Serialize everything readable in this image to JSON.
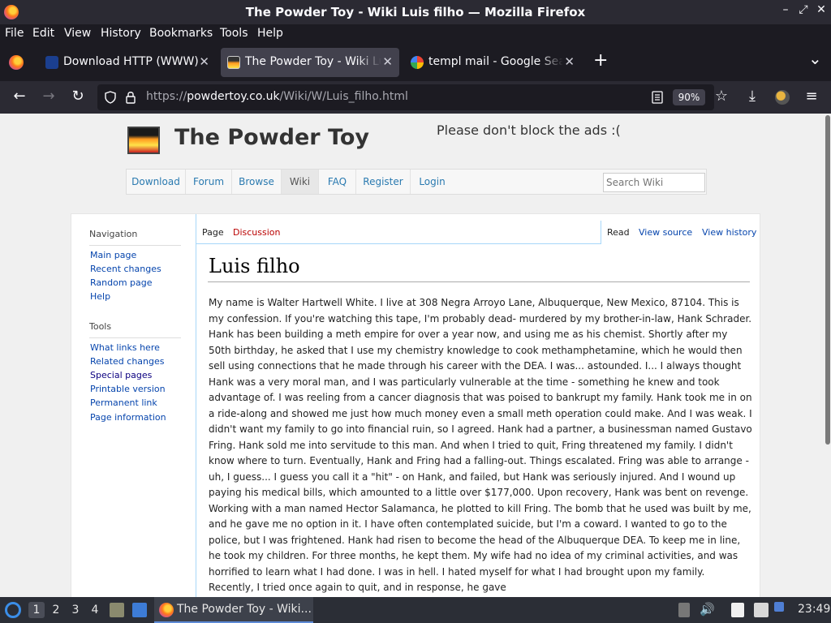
{
  "window": {
    "title": "The Powder Toy - Wiki Luis filho — Mozilla Firefox",
    "minimize": "–",
    "maximize": "⤢",
    "close": "✕"
  },
  "menu": [
    "File",
    "Edit",
    "View",
    "History",
    "Bookmarks",
    "Tools",
    "Help"
  ],
  "tabs": [
    {
      "label": "Download HTTP (WWW)",
      "active": false
    },
    {
      "label": "The Powder Toy - Wiki Lui",
      "active": true
    },
    {
      "label": "templ mail - Google Sear",
      "active": false
    }
  ],
  "tab_close": "✕",
  "new_tab": "+",
  "list_all_tabs": "⌄",
  "navbar": {
    "back": "←",
    "forward": "→",
    "reload": "↻",
    "url_prefix": "https://",
    "url_host": "powdertoy.co.uk",
    "url_path": "/Wiki/W/Luis_filho.html",
    "zoom": "90%",
    "bookmark_star": "☆",
    "downloads": "⤓",
    "menu": "≡"
  },
  "site": {
    "title": "The Powder Toy",
    "ads_message": "Please don't block the ads :(",
    "nav": [
      "Download",
      "Forum",
      "Browse",
      "Wiki",
      "FAQ",
      "Register",
      "Login"
    ],
    "search_placeholder": "Search Wiki"
  },
  "sidebar": {
    "navigation_heading": "Navigation",
    "navigation": [
      "Main page",
      "Recent changes",
      "Random page",
      "Help"
    ],
    "tools_heading": "Tools",
    "tools": [
      "What links here",
      "Related changes",
      "Special pages",
      "Printable version",
      "Permanent link",
      "Page information"
    ]
  },
  "content_tabs": {
    "page": "Page",
    "discussion": "Discussion",
    "read": "Read",
    "view_source": "View source",
    "view_history": "View history"
  },
  "article": {
    "title": "Luis filho",
    "body": "My name is Walter Hartwell White. I live at 308 Negra Arroyo Lane, Albuquerque, New Mexico, 87104. This is my confession. If you're watching this tape, I'm probably dead- murdered by my brother-in-law, Hank Schrader. Hank has been building a meth empire for over a year now, and using me as his chemist. Shortly after my 50th birthday, he asked that I use my chemistry knowledge to cook methamphetamine, which he would then sell using connections that he made through his career with the DEA. I was... astounded. I... I always thought Hank was a very moral man, and I was particularly vulnerable at the time - something he knew and took advantage of. I was reeling from a cancer diagnosis that was poised to bankrupt my family. Hank took me in on a ride-along and showed me just how much money even a small meth operation could make. And I was weak. I didn't want my family to go into financial ruin, so I agreed. Hank had a partner, a businessman named Gustavo Fring. Hank sold me into servitude to this man. And when I tried to quit, Fring threatened my family. I didn't know where to turn. Eventually, Hank and Fring had a falling-out. Things escalated. Fring was able to arrange - uh, I guess... I guess you call it a \"hit\" - on Hank, and failed, but Hank was seriously injured. And I wound up paying his medical bills, which amounted to a little over $177,000. Upon recovery, Hank was bent on revenge. Working with a man named Hector Salamanca, he plotted to kill Fring. The bomb that he used was built by me, and he gave me no option in it. I have often contemplated suicide, but I'm a coward. I wanted to go to the police, but I was frightened. Hank had risen to become the head of the Albuquerque DEA. To keep me in line, he took my children. For three months, he kept them. My wife had no idea of my criminal activities, and was horrified to learn what I had done. I was in hell. I hated myself for what I had brought upon my family. Recently, I tried once again to quit, and in response, he gave"
  },
  "taskbar": {
    "workspaces": [
      "1",
      "2",
      "3",
      "4"
    ],
    "window_label": "The Powder Toy - Wiki...",
    "clock": "23:49",
    "volume": "🔊"
  },
  "colors": {
    "accent_link": "#0645ad",
    "site_link": "#2a7ab0",
    "discussion_link": "#ba0000"
  }
}
